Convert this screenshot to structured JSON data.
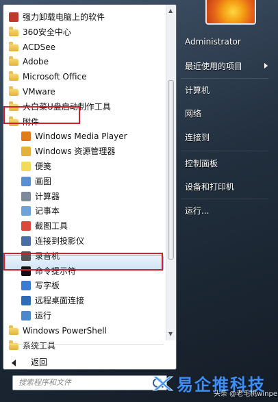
{
  "left_list": [
    {
      "label": "强力卸载电脑上的软件",
      "kind": "app",
      "icon": "uninstaller-icon",
      "color": "#c0392b"
    },
    {
      "label": "360安全中心",
      "kind": "folder",
      "icon": "folder-icon"
    },
    {
      "label": "ACDSee",
      "kind": "folder",
      "icon": "folder-icon"
    },
    {
      "label": "Adobe",
      "kind": "folder",
      "icon": "folder-icon"
    },
    {
      "label": "Microsoft Office",
      "kind": "folder",
      "icon": "folder-icon"
    },
    {
      "label": "VMware",
      "kind": "folder",
      "icon": "folder-icon"
    },
    {
      "label": "大白菜U盘启动制作工具",
      "kind": "folder",
      "icon": "folder-icon"
    },
    {
      "label": "附件",
      "kind": "folder",
      "icon": "folder-open-icon"
    },
    {
      "label": "Windows Media Player",
      "kind": "app",
      "icon": "media-player-icon",
      "color": "#e07b1a"
    },
    {
      "label": "Windows 资源管理器",
      "kind": "app",
      "icon": "explorer-icon",
      "color": "#e3b23c"
    },
    {
      "label": "便笺",
      "kind": "app",
      "icon": "sticky-notes-icon",
      "color": "#f0dc5a"
    },
    {
      "label": "画图",
      "kind": "app",
      "icon": "paint-icon",
      "color": "#5b8fd1"
    },
    {
      "label": "计算器",
      "kind": "app",
      "icon": "calculator-icon",
      "color": "#7c8a9a"
    },
    {
      "label": "记事本",
      "kind": "app",
      "icon": "notepad-icon",
      "color": "#6fa3d6"
    },
    {
      "label": "截图工具",
      "kind": "app",
      "icon": "snipping-tool-icon",
      "color": "#d84a3a"
    },
    {
      "label": "连接到投影仪",
      "kind": "app",
      "icon": "projector-icon",
      "color": "#4a6fa5"
    },
    {
      "label": "录音机",
      "kind": "app",
      "icon": "microphone-icon",
      "color": "#555555"
    },
    {
      "label": "命令提示符",
      "kind": "app",
      "icon": "command-prompt-icon",
      "color": "#111111"
    },
    {
      "label": "写字板",
      "kind": "app",
      "icon": "wordpad-icon",
      "color": "#3a7bd5"
    },
    {
      "label": "远程桌面连接",
      "kind": "app",
      "icon": "remote-desktop-icon",
      "color": "#2d6cb5"
    },
    {
      "label": "运行",
      "kind": "app",
      "icon": "run-icon",
      "color": "#4a88c9"
    },
    {
      "label": "Windows PowerShell",
      "kind": "folder",
      "icon": "folder-icon"
    },
    {
      "label": "系统工具",
      "kind": "folder",
      "icon": "folder-icon"
    }
  ],
  "back_label": "返回",
  "search_placeholder": "搜索程序和文件",
  "right_menu": {
    "user": "Administrator",
    "recent": "最近使用的项目",
    "computer": "计算机",
    "network": "网络",
    "connect": "连接到",
    "control_panel": "控制面板",
    "devices": "设备和打印机",
    "run": "运行..."
  },
  "watermark": {
    "brand": "易企推科技",
    "sub": "头条 @老毛桃winpe"
  },
  "colors": {
    "highlight_border": "#d0202a",
    "accent_blue": "#3f8ff2"
  }
}
